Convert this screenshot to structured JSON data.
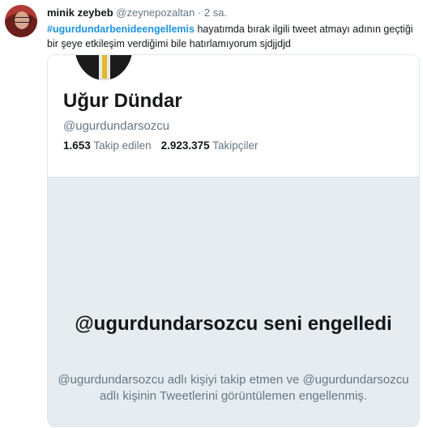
{
  "tweet": {
    "author_name": "minik zeybeb",
    "author_handle": "@zeynepozaltan",
    "separator": "·",
    "time": "2 sa.",
    "hashtag": "#ugurdundarbenideengellemis",
    "text": " hayatımda bırak ilgili tweet atmayı adının geçtiği bir şeye etkileşim verdiğimi bile hatırlamıyorum sjdjjdjd"
  },
  "profile_card": {
    "name": "Uğur Dündar",
    "handle": "@ugurdundarsozcu",
    "following_count": "1.653",
    "following_label": "Takip edilen",
    "followers_count": "2.923.375",
    "followers_label": "Takipçiler"
  },
  "blocked_notice": {
    "title": "@ugurdundarsozcu seni engelledi",
    "description": "@ugurdundarsozcu adlı kişiyi takip etmen ve @ugurdundarsozcu adlı kişinin Tweetlerini görüntülemen engellenmiş."
  }
}
